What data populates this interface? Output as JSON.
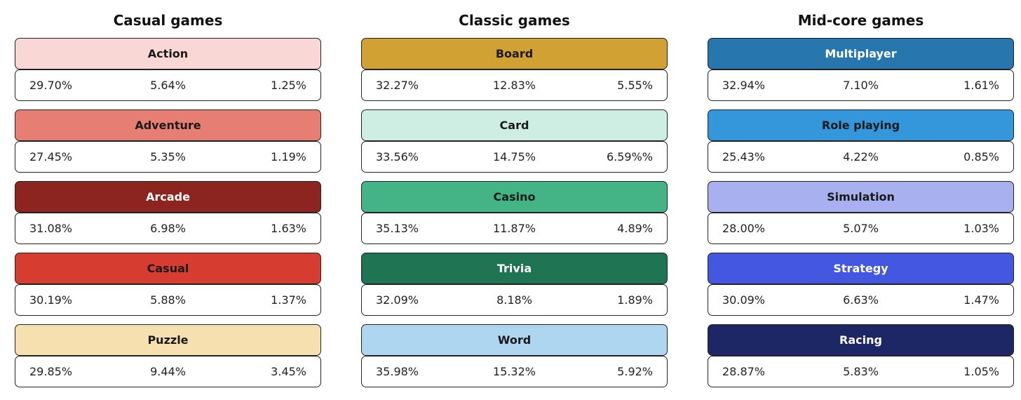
{
  "columns": [
    {
      "title": "Casual games",
      "genres": [
        {
          "name": "Action",
          "color": "#F8D7D4",
          "text_color": "#1a1a1a",
          "values": [
            "29.70%",
            "5.64%",
            "1.25%"
          ]
        },
        {
          "name": "Adventure",
          "color": "#E67E74",
          "text_color": "#1a1a1a",
          "values": [
            "27.45%",
            "5.35%",
            "1.19%"
          ]
        },
        {
          "name": "Arcade",
          "color": "#8C2420",
          "text_color": "#ffffff",
          "values": [
            "31.08%",
            "6.98%",
            "1.63%"
          ]
        },
        {
          "name": "Casual",
          "color": "#D63C2F",
          "text_color": "#1a1a1a",
          "values": [
            "30.19%",
            "5.88%",
            "1.37%"
          ]
        },
        {
          "name": "Puzzle",
          "color": "#F6E0B0",
          "text_color": "#1a1a1a",
          "values": [
            "29.85%",
            "9.44%",
            "3.45%"
          ]
        }
      ]
    },
    {
      "title": "Classic games",
      "genres": [
        {
          "name": "Board",
          "color": "#D1A134",
          "text_color": "#1a1a1a",
          "values": [
            "32.27%",
            "12.83%",
            "5.55%"
          ]
        },
        {
          "name": "Card",
          "color": "#CFEEE3",
          "text_color": "#1a1a1a",
          "values": [
            "33.56%",
            "14.75%",
            "6.59%%"
          ]
        },
        {
          "name": "Casino",
          "color": "#44B386",
          "text_color": "#1a1a1a",
          "values": [
            "35.13%",
            "11.87%",
            "4.89%"
          ]
        },
        {
          "name": "Trivia",
          "color": "#1E7453",
          "text_color": "#ffffff",
          "values": [
            "32.09%",
            "8.18%",
            "1.89%"
          ]
        },
        {
          "name": "Word",
          "color": "#AED6F0",
          "text_color": "#1a1a1a",
          "values": [
            "35.98%",
            "15.32%",
            "5.92%"
          ]
        }
      ]
    },
    {
      "title": "Mid-core games",
      "genres": [
        {
          "name": "Multiplayer",
          "color": "#2776AD",
          "text_color": "#ffffff",
          "values": [
            "32.94%",
            "7.10%",
            "1.61%"
          ]
        },
        {
          "name": "Role playing",
          "color": "#3497DC",
          "text_color": "#1a1a1a",
          "values": [
            "25.43%",
            "4.22%",
            "0.85%"
          ]
        },
        {
          "name": "Simulation",
          "color": "#A8B0F0",
          "text_color": "#1a1a1a",
          "values": [
            "28.00%",
            "5.07%",
            "1.03%"
          ]
        },
        {
          "name": "Strategy",
          "color": "#4357E0",
          "text_color": "#ffffff",
          "values": [
            "30.09%",
            "6.63%",
            "1.47%"
          ]
        },
        {
          "name": "Racing",
          "color": "#1E2766",
          "text_color": "#ffffff",
          "values": [
            "28.87%",
            "5.83%",
            "1.05%"
          ]
        }
      ]
    }
  ]
}
